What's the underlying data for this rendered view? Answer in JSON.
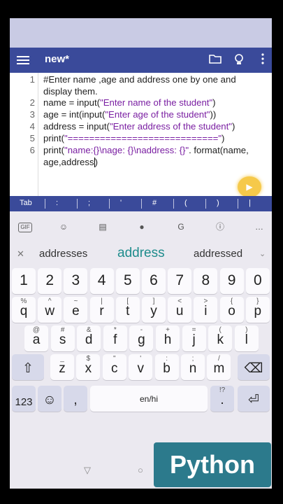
{
  "app": {
    "title": "new*",
    "icons": [
      "menu-icon",
      "folder-icon",
      "bulb-icon",
      "more-vert-icon"
    ]
  },
  "editor": {
    "lines": [
      {
        "num": "1",
        "parts": [
          {
            "t": "#Enter name ,age and address one by one and\ndisplay them.",
            "c": "plain"
          }
        ]
      },
      {
        "num": "2",
        "parts": [
          {
            "t": "name = input(",
            "c": "plain"
          },
          {
            "t": "\"Enter name of the student\"",
            "c": "str"
          },
          {
            "t": ")",
            "c": "plain"
          }
        ]
      },
      {
        "num": "3",
        "parts": [
          {
            "t": "age = int(input(",
            "c": "plain"
          },
          {
            "t": "\"Enter age of the student\"",
            "c": "str"
          },
          {
            "t": "))",
            "c": "plain"
          }
        ]
      },
      {
        "num": "4",
        "parts": [
          {
            "t": "address = input(",
            "c": "plain"
          },
          {
            "t": "\"Enter address of the student\"",
            "c": "str"
          },
          {
            "t": ")",
            "c": "plain"
          }
        ]
      },
      {
        "num": "5",
        "parts": [
          {
            "t": "print(",
            "c": "plain"
          },
          {
            "t": "\"============================\"",
            "c": "str"
          },
          {
            "t": ")",
            "c": "plain"
          }
        ]
      },
      {
        "num": "6",
        "parts": [
          {
            "t": "print(",
            "c": "plain"
          },
          {
            "t": "\"name:{}\\nage: {}\\naddress: {}\"",
            "c": "str"
          },
          {
            "t": ". format(name,\nage,address)",
            "c": "plain"
          }
        ]
      }
    ]
  },
  "tabbar": {
    "keys": [
      "Tab",
      ":",
      ";",
      "'",
      "#",
      "(",
      ")",
      "|"
    ]
  },
  "keyboard": {
    "tools": [
      "gif-icon",
      "sticker-icon",
      "clipboard-icon",
      "mic-icon",
      "translate-icon",
      "info-icon",
      "more-icon"
    ],
    "suggestions": {
      "left": "addresses",
      "middle": "address",
      "right": "addressed"
    },
    "row_numbers": [
      "1",
      "2",
      "3",
      "4",
      "5",
      "6",
      "7",
      "8",
      "9",
      "0"
    ],
    "row1": [
      [
        "q",
        "%"
      ],
      [
        "w",
        "^"
      ],
      [
        "e",
        "~"
      ],
      [
        "r",
        "|"
      ],
      [
        "t",
        "["
      ],
      [
        "y",
        "]"
      ],
      [
        "u",
        "<"
      ],
      [
        "i",
        ">"
      ],
      [
        "o",
        "{"
      ],
      [
        "p",
        "}"
      ]
    ],
    "row2": [
      [
        "a",
        "@"
      ],
      [
        "s",
        "#"
      ],
      [
        "d",
        "&"
      ],
      [
        "f",
        "*"
      ],
      [
        "g",
        "-"
      ],
      [
        "h",
        "+"
      ],
      [
        "j",
        "="
      ],
      [
        "k",
        "("
      ],
      [
        "l",
        ")"
      ]
    ],
    "row3": [
      [
        "z",
        "_"
      ],
      [
        "x",
        "$"
      ],
      [
        "c",
        "\""
      ],
      [
        "v",
        "'"
      ],
      [
        "b",
        ":"
      ],
      [
        "n",
        ";"
      ],
      [
        "m",
        "/"
      ]
    ],
    "bottom": {
      "sym": "123",
      "comma": ",",
      "space": "en/hi",
      "period": ".",
      "period_alt": "!?"
    }
  },
  "badge": {
    "text": "Python"
  }
}
